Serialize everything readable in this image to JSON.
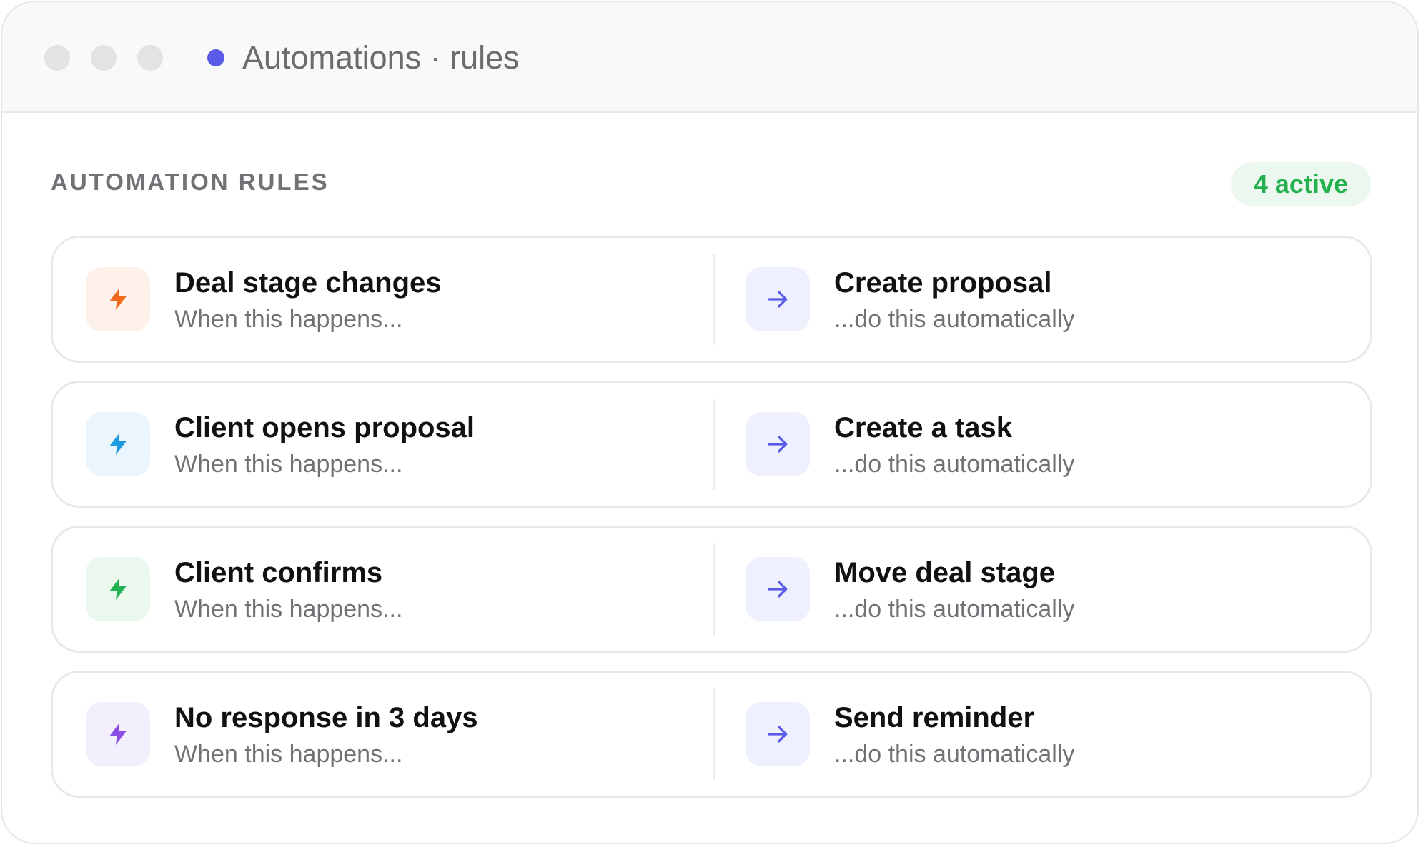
{
  "window": {
    "title": "Automations · rules"
  },
  "section": {
    "title": "AUTOMATION RULES",
    "badge": "4 active"
  },
  "colors": {
    "status_dot": "#5b5bea",
    "badge_text": "#23b14d",
    "badge_bg": "#ecf8ef",
    "action_icon": "#5b5bea",
    "action_icon_bg": "#eef0fd"
  },
  "rules": [
    {
      "trigger": {
        "title": "Deal stage changes",
        "subtitle": "When this happens...",
        "icon": "bolt-icon",
        "color": "#f26b1d",
        "bg": "#fdf1ea"
      },
      "action": {
        "title": "Create proposal",
        "subtitle": "...do this automatically",
        "icon": "arrow-right-icon"
      }
    },
    {
      "trigger": {
        "title": "Client opens proposal",
        "subtitle": "When this happens...",
        "icon": "bolt-icon",
        "color": "#1e9ae0",
        "bg": "#ebf5fd"
      },
      "action": {
        "title": "Create a task",
        "subtitle": "...do this automatically",
        "icon": "arrow-right-icon"
      }
    },
    {
      "trigger": {
        "title": "Client confirms",
        "subtitle": "When this happens...",
        "icon": "bolt-icon",
        "color": "#22b251",
        "bg": "#eaf8ee"
      },
      "action": {
        "title": "Move deal stage",
        "subtitle": "...do this automatically",
        "icon": "arrow-right-icon"
      }
    },
    {
      "trigger": {
        "title": "No response in 3 days",
        "subtitle": "When this happens...",
        "icon": "bolt-icon",
        "color": "#8b4fe6",
        "bg": "#f3effd"
      },
      "action": {
        "title": "Send reminder",
        "subtitle": "...do this automatically",
        "icon": "arrow-right-icon"
      }
    }
  ]
}
